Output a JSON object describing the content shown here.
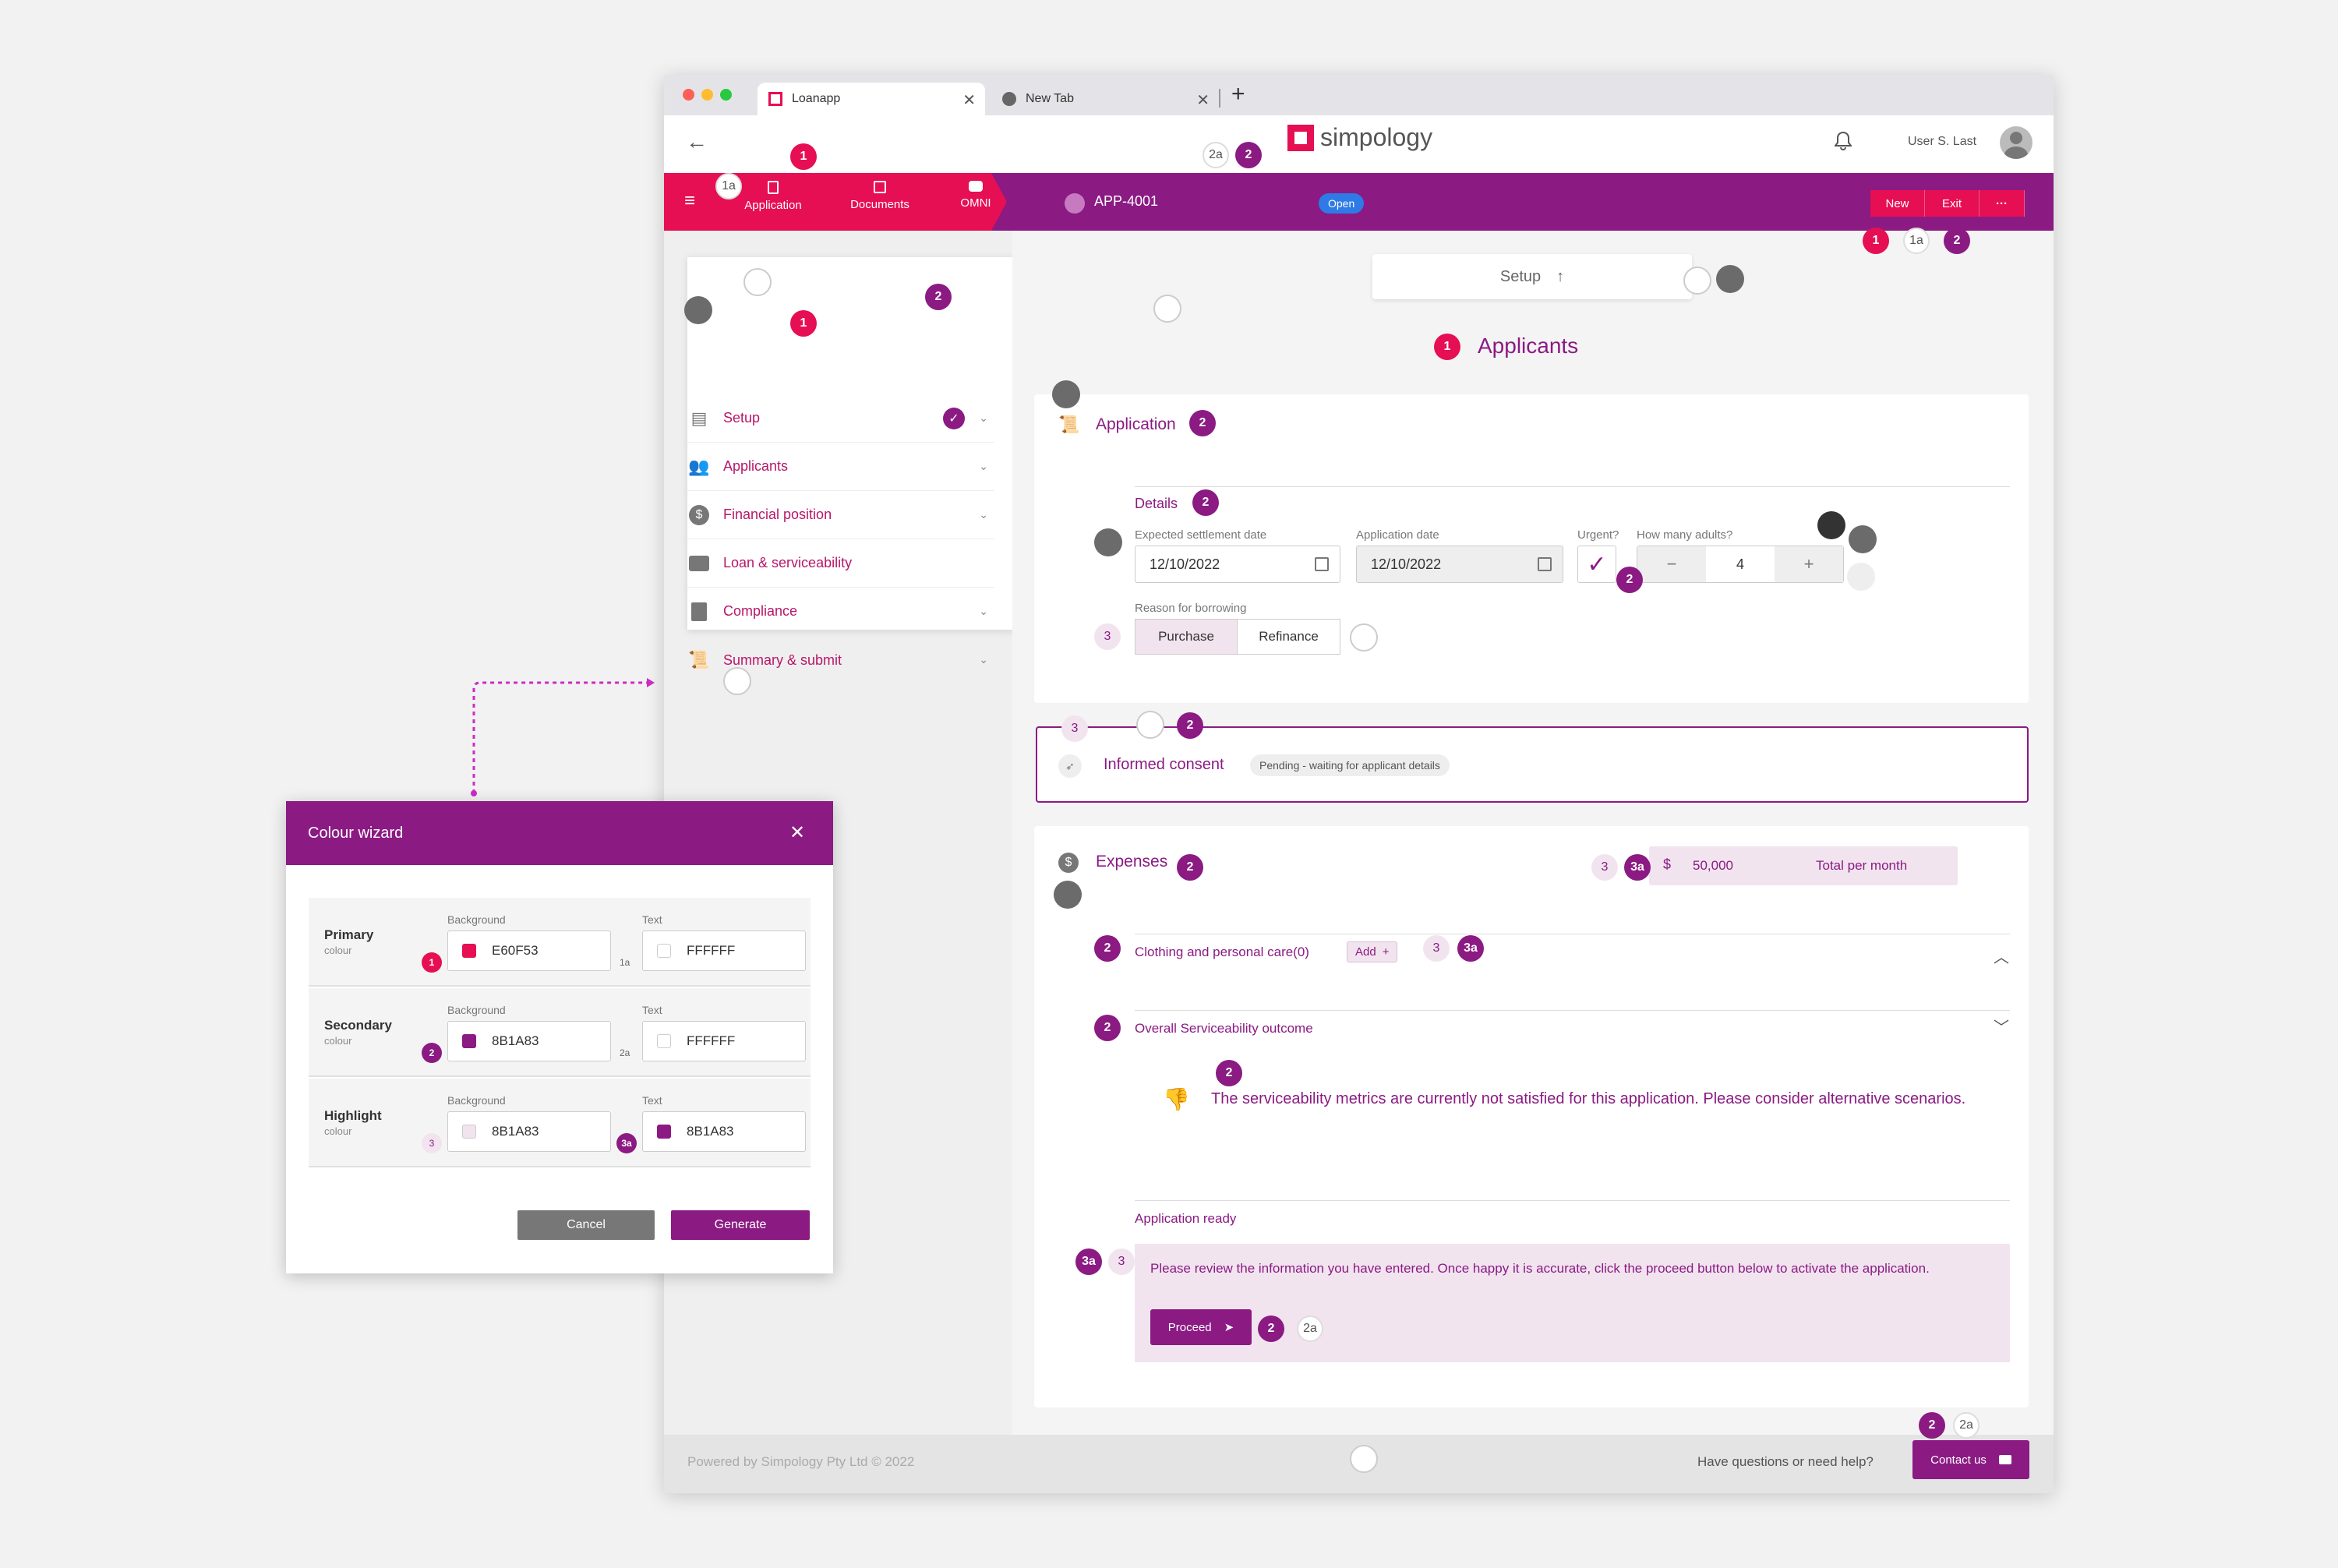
{
  "browser": {
    "tabs": [
      {
        "label": "Loanapp",
        "close": "✕"
      },
      {
        "label": "New Tab",
        "close": "✕"
      }
    ],
    "new_tab": "+"
  },
  "header": {
    "brand": "simpology",
    "user_name": "User S. Last",
    "back": "←"
  },
  "nav": {
    "menu": "≡",
    "items": [
      {
        "label": "Application"
      },
      {
        "label": "Documents"
      },
      {
        "label": "OMNI"
      }
    ],
    "app_id": "APP-4001",
    "status": "Open",
    "actions": [
      "New",
      "Exit",
      "···"
    ]
  },
  "sidebar": {
    "items": [
      {
        "label": "Setup"
      },
      {
        "label": "Applicants"
      },
      {
        "label": "Financial position"
      },
      {
        "label": "Loan & serviceability"
      },
      {
        "label": "Compliance"
      },
      {
        "label": "Summary & submit"
      }
    ]
  },
  "main": {
    "setup_label": "Setup",
    "section_title": "Applicants",
    "application": {
      "title": "Application",
      "details_title": "Details",
      "settlement_label": "Expected settlement date",
      "settlement_value": "12/10/2022",
      "appdate_label": "Application date",
      "appdate_value": "12/10/2022",
      "urgent_label": "Urgent?",
      "adults_label": "How many adults?",
      "adults_value": "4",
      "minus": "−",
      "plus": "+",
      "reason_label": "Reason for borrowing",
      "reason_options": [
        "Purchase",
        "Refinance"
      ]
    },
    "consent": {
      "title": "Informed consent",
      "status": "Pending - waiting for applicant details"
    },
    "expenses": {
      "title": "Expenses",
      "currency": "$",
      "amount": "50,000",
      "total_label": "Total per month",
      "clothing": "Clothing and personal care(0)",
      "add": "Add",
      "add_plus": "+",
      "outcome_title": "Overall Serviceability outcome",
      "outcome_msg": "The serviceability metrics are currently not satisfied for this application. Please consider alternative scenarios.",
      "ready_title": "Application ready",
      "ready_msg": "Please review the information you have entered. Once happy it is accurate, click the proceed button below to activate the application.",
      "proceed": "Proceed"
    }
  },
  "footer": {
    "copyright": "Powered by Simpology Pty Ltd © 2022",
    "help": "Have questions or need help?",
    "contact": "Contact us"
  },
  "wizard": {
    "title": "Colour wizard",
    "close": "✕",
    "bg_label": "Background",
    "text_label": "Text",
    "colour_word": "colour",
    "rows": [
      {
        "name": "Primary",
        "bg": "E60F53",
        "text": "FFFFFF",
        "bg_color": "#e60f53",
        "text_color": "#ffffff"
      },
      {
        "name": "Secondary",
        "bg": "8B1A83",
        "text": "FFFFFF",
        "bg_color": "#8b1a83",
        "text_color": "#ffffff"
      },
      {
        "name": "Highlight",
        "bg": "8B1A83",
        "text": "8B1A83",
        "bg_color": "#f1e4ef",
        "text_color": "#8b1a83"
      }
    ],
    "cancel": "Cancel",
    "generate": "Generate"
  },
  "markers": {
    "one": "1",
    "one_a": "1a",
    "two": "2",
    "two_a": "2a",
    "three": "3",
    "three_a": "3a"
  },
  "colors": {
    "primary": "#E60F53",
    "secondary": "#8B1A83",
    "highlight_bg": "#F1E4EF"
  }
}
